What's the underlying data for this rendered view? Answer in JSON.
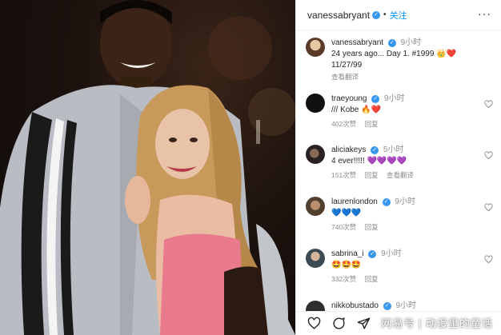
{
  "post": {
    "author": "vanessabryant",
    "follow_label": "关注",
    "more_label": "···"
  },
  "comments": [
    {
      "user": "vanessabryant",
      "time": "9小时",
      "text": "24 years ago... Day 1. #1999 👑❤️",
      "text2": "11/27/99",
      "actions": [
        "查看翻译"
      ],
      "avatar": "vanessa-avatar"
    },
    {
      "user": "traeyoung",
      "time": "9小时",
      "text": "/// Kobe 🔥❤️",
      "actions": [
        "402次赞",
        "回复"
      ],
      "avatar": "trae-avatar"
    },
    {
      "user": "aliciakeys",
      "time": "5小时",
      "text": "4 ever!!!!! 💜💜💜💜",
      "actions": [
        "151次赞",
        "回复",
        "查看翻译"
      ],
      "avatar": "alicia-avatar"
    },
    {
      "user": "laurenlondon",
      "time": "9小时",
      "text": "💙💙💙",
      "actions": [
        "740次赞",
        "回复"
      ],
      "avatar": "lauren-avatar"
    },
    {
      "user": "sabrina_i",
      "time": "9小时",
      "text": "🤩🤩🤩",
      "actions": [
        "332次赞",
        "回复"
      ],
      "avatar": "sabrina-avatar"
    },
    {
      "user": "nikkobustado",
      "time": "9小时",
      "text": "",
      "actions": [],
      "avatar": "nikko-avatar"
    }
  ],
  "watermark": "网易号 | 动漫里的童话",
  "colors": {
    "accent": "#0095f6",
    "verified": "#3897f0",
    "muted": "#8e8e8e"
  },
  "icons": [
    "more-icon",
    "heart-outline-icon",
    "heart-icon",
    "comment-icon",
    "share-icon",
    "bookmark-icon",
    "verified-icon"
  ]
}
